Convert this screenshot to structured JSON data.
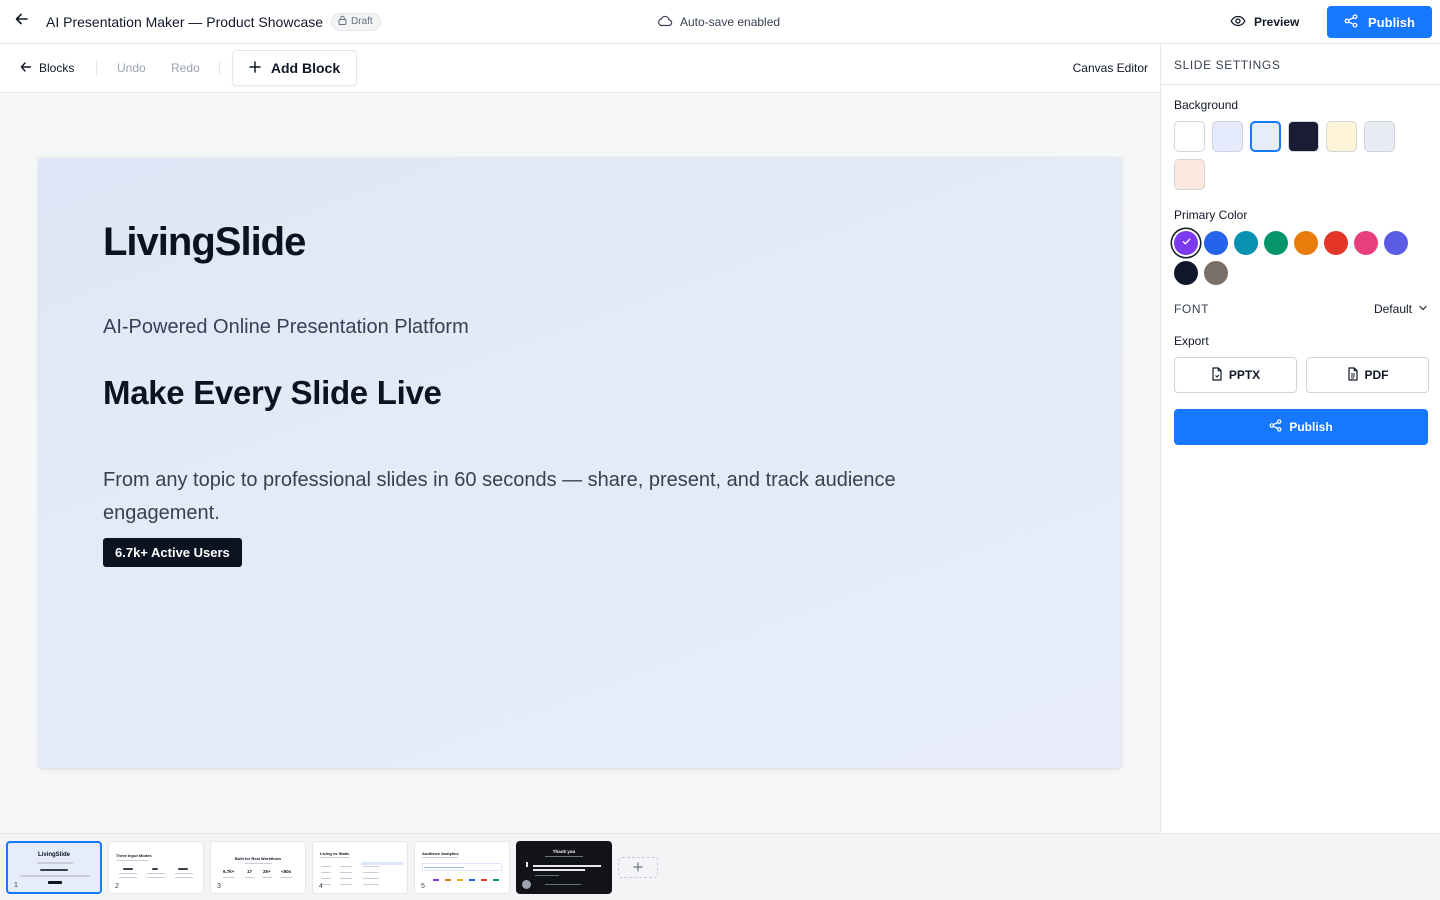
{
  "header": {
    "title": "AI Presentation Maker — Product Showcase",
    "status_badge": "Draft",
    "autosave": "Auto-save enabled",
    "preview_label": "Preview",
    "publish_label": "Publish"
  },
  "toolbar": {
    "blocks_label": "Blocks",
    "undo_label": "Undo",
    "redo_label": "Redo",
    "add_block_label": "Add Block",
    "mode_label": "Canvas Editor"
  },
  "slide": {
    "logo": "LivingSlide",
    "subtitle": "AI-Powered Online Presentation Platform",
    "headline": "Make Every Slide Live",
    "body": "From any topic to professional slides in 60 seconds — share, present, and track audience engagement.",
    "badge": "6.7k+ Active Users"
  },
  "settings": {
    "title": "SLIDE SETTINGS",
    "background_label": "Background",
    "backgrounds": [
      "#ffffff",
      "#e4e9fb",
      "#e6ecf8",
      "#1a1c33",
      "#fdf3d8",
      "#e9ebf2",
      "#fde8e0"
    ],
    "background_selected": 2,
    "primary_color_label": "Primary Color",
    "primary_colors": [
      "#7c3aed",
      "#2563eb",
      "#0891b2",
      "#059669",
      "#ea7c0c",
      "#e5362a",
      "#e8407f",
      "#5b5ce6",
      "#0f172a",
      "#7a6f67"
    ],
    "primary_selected": 0,
    "font_label": "FONT",
    "font_value": "Default",
    "export_label": "Export",
    "export_pptx": "PPTX",
    "export_pdf": "PDF",
    "publish_label": "Publish"
  },
  "thumbnails": {
    "items": [
      {
        "number": "1",
        "title": "LivingSlide"
      },
      {
        "number": "2",
        "title": "Three Input Modes"
      },
      {
        "number": "3",
        "title": "Built for Real Workflows"
      },
      {
        "number": "4",
        "title": "Living vs Static"
      },
      {
        "number": "5",
        "title": "Audience Analytics"
      },
      {
        "number": "6",
        "title": "Thank you"
      }
    ],
    "stats_3": [
      "6.7k+",
      "17",
      "25+",
      "<60s"
    ]
  }
}
